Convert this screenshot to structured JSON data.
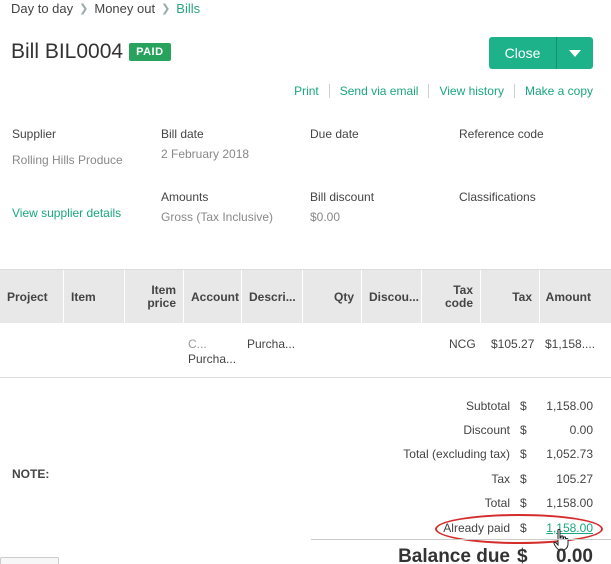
{
  "breadcrumb": {
    "items": [
      "Day to day",
      "Money out"
    ],
    "current": "Bills"
  },
  "header": {
    "title": "Bill BIL0004",
    "status_badge": "PAID",
    "close_label": "Close"
  },
  "actions": [
    "Print",
    "Send via email",
    "View history",
    "Make a copy"
  ],
  "details": {
    "supplier_label": "Supplier",
    "supplier_value": "Rolling Hills Produce",
    "bill_date_label": "Bill date",
    "bill_date_value": "2 February 2018",
    "due_date_label": "Due date",
    "reference_label": "Reference code",
    "amounts_label": "Amounts",
    "amounts_value": "Gross (Tax Inclusive)",
    "discount_label": "Bill discount",
    "discount_value": "$0.00",
    "classifications_label": "Classifications",
    "view_supplier_link": "View supplier details"
  },
  "table": {
    "columns": {
      "project": "Project",
      "item": "Item",
      "item_price_1": "Item",
      "item_price_2": "price",
      "account": "Account",
      "description": "Descri...",
      "qty": "Qty",
      "discount": "Discou...",
      "tax_code_1": "Tax",
      "tax_code_2": "code",
      "tax": "Tax",
      "amount": "Amount"
    },
    "row": {
      "account_1": "C...",
      "account_2": "Purcha...",
      "description": "Purcha...",
      "tax_code": "NCG",
      "tax": "$105.27",
      "amount": "$1,158...."
    }
  },
  "note_label": "NOTE:",
  "totals": {
    "currency": "$",
    "subtotal_label": "Subtotal",
    "subtotal_value": "1,158.00",
    "discount_label": "Discount",
    "discount_value": "0.00",
    "excl_label": "Total (excluding tax)",
    "excl_value": "1,052.73",
    "tax_label": "Tax",
    "tax_value": "105.27",
    "total_label": "Total",
    "total_value": "1,158.00",
    "paid_label": "Already paid",
    "paid_value": "1,158.00",
    "balance_label": "Balance due",
    "balance_value": "0.00"
  },
  "colors": {
    "accent": "#1db28a",
    "paid_badge": "#27a35e",
    "annotation": "#d42b2b"
  }
}
